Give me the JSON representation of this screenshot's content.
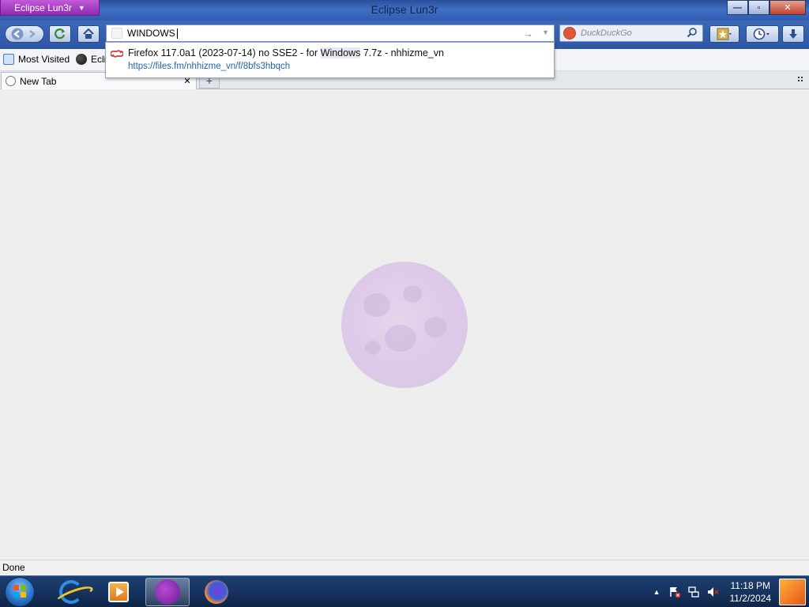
{
  "window": {
    "app_menu_label": "Eclipse Lun3r",
    "title": "Eclipse Lun3r",
    "controls": {
      "minimize": "—",
      "maximize": "▫",
      "close": "✕"
    }
  },
  "toolbar": {
    "back_icon": "back-arrow-icon",
    "forward_icon": "forward-arrow-icon",
    "reload_icon": "reload-icon",
    "home_icon": "home-icon"
  },
  "urlbar": {
    "value": "WINDOWS",
    "go_symbol": "→",
    "dropdown_symbol": "▼"
  },
  "search": {
    "engine_icon": "duckduckgo-icon",
    "placeholder": "DuckDuckGo"
  },
  "bookmarks": {
    "items": [
      {
        "label": "Most Visited",
        "icon": "most-visited-icon"
      },
      {
        "label": "Ecli",
        "icon": "eclipse-icon"
      }
    ]
  },
  "tabs": {
    "items": [
      {
        "label": "New Tab",
        "close": "✕"
      }
    ],
    "new_tab": "+"
  },
  "autocomplete": {
    "items": [
      {
        "title_before": "Firefox 117.0a1 (2023-07-14) no SSE2 - for ",
        "title_match": "Windows",
        "title_after": " 7.7z - nhhizme_vn",
        "url": "https://files.fm/nhhizme_vn/f/8bfs3hbqch"
      }
    ]
  },
  "status": {
    "text": "Done"
  },
  "taskbar": {
    "pinned": [
      "internet-explorer-icon",
      "media-player-icon",
      "eclipse-lun3r-icon",
      "firefox-icon"
    ],
    "active_index": 2,
    "tray_arrow": "▲",
    "clock": {
      "time": "11:18 PM",
      "date": "11/2/2024"
    }
  },
  "colors": {
    "titlebar": "#3f6fc4",
    "app_button": "#a63fc8",
    "content_bg": "#eeeeee",
    "link": "#1f64b5",
    "logo": "#dcc6e8"
  }
}
